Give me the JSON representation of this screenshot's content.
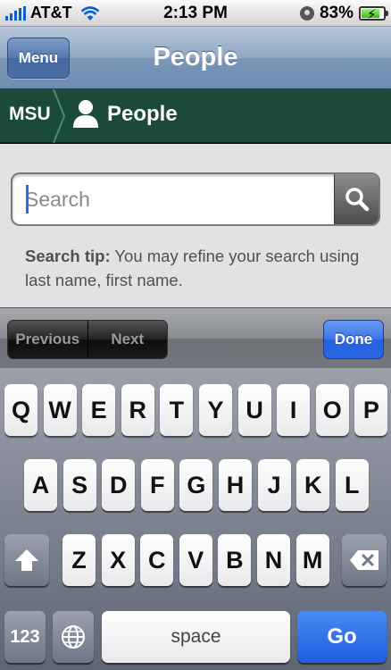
{
  "status_bar": {
    "carrier": "AT&T",
    "time": "2:13 PM",
    "battery": "83%",
    "battery_level": 0.83
  },
  "nav": {
    "menu_label": "Menu",
    "title": "People"
  },
  "breadcrumb": {
    "root": "MSU",
    "current": "People"
  },
  "search": {
    "placeholder": "Search",
    "value": ""
  },
  "tip": {
    "label": "Search tip:",
    "text": " You may refine your search using last name, first name."
  },
  "accessory": {
    "previous": "Previous",
    "next": "Next",
    "done": "Done"
  },
  "keyboard": {
    "row1": [
      "Q",
      "W",
      "E",
      "R",
      "T",
      "Y",
      "U",
      "I",
      "O",
      "P"
    ],
    "row2": [
      "A",
      "S",
      "D",
      "F",
      "G",
      "H",
      "J",
      "K",
      "L"
    ],
    "row3": [
      "Z",
      "X",
      "C",
      "V",
      "B",
      "N",
      "M"
    ],
    "numbers_key": "123",
    "space_key": "space",
    "go_key": "Go"
  },
  "colors": {
    "breadcrumb_bg": "#1c4a3a",
    "done_blue": "#2360e1",
    "nav_blue": "#6d8cb1"
  }
}
